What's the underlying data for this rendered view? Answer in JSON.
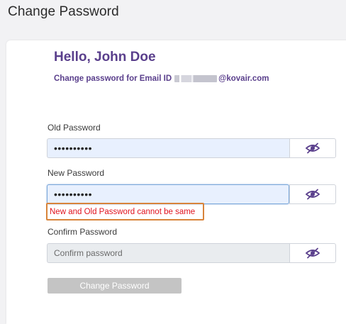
{
  "page": {
    "title": "Change Password"
  },
  "card": {
    "greeting": "Hello, John Doe",
    "email_prefix": "Change password for Email ID",
    "email_domain": "@kovair.com"
  },
  "form": {
    "old_password": {
      "label": "Old Password",
      "value": "••••••••••"
    },
    "new_password": {
      "label": "New Password",
      "value": "••••••••••"
    },
    "confirm_password": {
      "label": "Confirm Password",
      "placeholder": "Confirm password"
    },
    "error_message": "New and Old Password cannot be same",
    "submit_label": "Change Password"
  },
  "icons": {
    "toggle_visibility": "eye-slash-icon"
  },
  "colors": {
    "accent": "#5a3f8c",
    "error_text": "#e0131f",
    "error_border": "#d8843a",
    "button_disabled": "#c4c4c4"
  }
}
